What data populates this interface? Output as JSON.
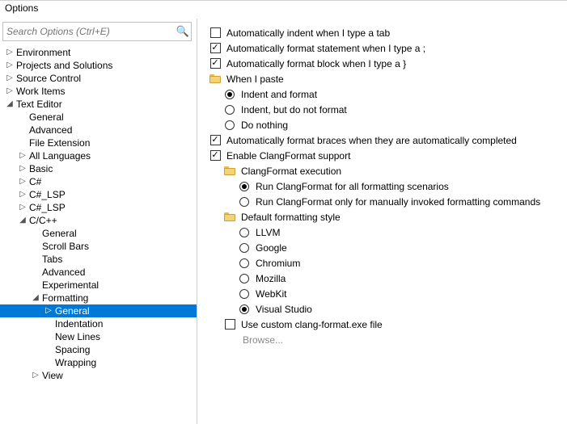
{
  "window": {
    "title": "Options"
  },
  "search": {
    "placeholder": "Search Options (Ctrl+E)"
  },
  "tree": [
    {
      "label": "Environment",
      "indent": 0,
      "arrow": "right",
      "selected": false
    },
    {
      "label": "Projects and Solutions",
      "indent": 0,
      "arrow": "right",
      "selected": false
    },
    {
      "label": "Source Control",
      "indent": 0,
      "arrow": "right",
      "selected": false
    },
    {
      "label": "Work Items",
      "indent": 0,
      "arrow": "right",
      "selected": false
    },
    {
      "label": "Text Editor",
      "indent": 0,
      "arrow": "down",
      "selected": false
    },
    {
      "label": "General",
      "indent": 1,
      "arrow": "none",
      "selected": false
    },
    {
      "label": "Advanced",
      "indent": 1,
      "arrow": "none",
      "selected": false
    },
    {
      "label": "File Extension",
      "indent": 1,
      "arrow": "none",
      "selected": false
    },
    {
      "label": "All Languages",
      "indent": 1,
      "arrow": "right",
      "selected": false
    },
    {
      "label": "Basic",
      "indent": 1,
      "arrow": "right",
      "selected": false
    },
    {
      "label": "C#",
      "indent": 1,
      "arrow": "right",
      "selected": false
    },
    {
      "label": "C#_LSP",
      "indent": 1,
      "arrow": "right",
      "selected": false
    },
    {
      "label": "C#_LSP",
      "indent": 1,
      "arrow": "right",
      "selected": false
    },
    {
      "label": "C/C++",
      "indent": 1,
      "arrow": "down",
      "selected": false
    },
    {
      "label": "General",
      "indent": 2,
      "arrow": "none",
      "selected": false
    },
    {
      "label": "Scroll Bars",
      "indent": 2,
      "arrow": "none",
      "selected": false
    },
    {
      "label": "Tabs",
      "indent": 2,
      "arrow": "none",
      "selected": false
    },
    {
      "label": "Advanced",
      "indent": 2,
      "arrow": "none",
      "selected": false
    },
    {
      "label": "Experimental",
      "indent": 2,
      "arrow": "none",
      "selected": false
    },
    {
      "label": "Formatting",
      "indent": 2,
      "arrow": "down",
      "selected": false
    },
    {
      "label": "General",
      "indent": 3,
      "arrow": "none",
      "selected": true
    },
    {
      "label": "Indentation",
      "indent": 3,
      "arrow": "none",
      "selected": false
    },
    {
      "label": "New Lines",
      "indent": 3,
      "arrow": "none",
      "selected": false
    },
    {
      "label": "Spacing",
      "indent": 3,
      "arrow": "none",
      "selected": false
    },
    {
      "label": "Wrapping",
      "indent": 3,
      "arrow": "none",
      "selected": false
    },
    {
      "label": "View",
      "indent": 2,
      "arrow": "right",
      "selected": false
    }
  ],
  "options": [
    {
      "type": "checkbox",
      "checked": false,
      "indent": 0,
      "label": "Automatically indent when I type a tab"
    },
    {
      "type": "checkbox",
      "checked": true,
      "indent": 0,
      "label": "Automatically format statement when I type a ;"
    },
    {
      "type": "checkbox",
      "checked": true,
      "indent": 0,
      "label": "Automatically format block when I type a }"
    },
    {
      "type": "folder",
      "checked": false,
      "indent": 0,
      "label": "When I paste"
    },
    {
      "type": "radio",
      "checked": true,
      "indent": 1,
      "label": "Indent and format"
    },
    {
      "type": "radio",
      "checked": false,
      "indent": 1,
      "label": "Indent, but do not format"
    },
    {
      "type": "radio",
      "checked": false,
      "indent": 1,
      "label": "Do nothing"
    },
    {
      "type": "checkbox",
      "checked": true,
      "indent": 0,
      "label": "Automatically format braces when they are automatically completed"
    },
    {
      "type": "checkbox",
      "checked": true,
      "indent": 0,
      "label": "Enable ClangFormat support"
    },
    {
      "type": "folder",
      "checked": false,
      "indent": 1,
      "label": "ClangFormat execution"
    },
    {
      "type": "radio",
      "checked": true,
      "indent": 2,
      "label": "Run ClangFormat for all formatting scenarios"
    },
    {
      "type": "radio",
      "checked": false,
      "indent": 2,
      "label": "Run ClangFormat only for manually invoked formatting commands"
    },
    {
      "type": "folder",
      "checked": false,
      "indent": 1,
      "label": "Default formatting style"
    },
    {
      "type": "radio",
      "checked": false,
      "indent": 2,
      "label": "LLVM"
    },
    {
      "type": "radio",
      "checked": false,
      "indent": 2,
      "label": "Google"
    },
    {
      "type": "radio",
      "checked": false,
      "indent": 2,
      "label": "Chromium"
    },
    {
      "type": "radio",
      "checked": false,
      "indent": 2,
      "label": "Mozilla"
    },
    {
      "type": "radio",
      "checked": false,
      "indent": 2,
      "label": "WebKit"
    },
    {
      "type": "radio",
      "checked": true,
      "indent": 2,
      "label": "Visual Studio"
    },
    {
      "type": "checkbox",
      "checked": false,
      "indent": 1,
      "label": "Use custom clang-format.exe file"
    },
    {
      "type": "browse",
      "checked": false,
      "indent": 2,
      "label": "Browse..."
    }
  ]
}
